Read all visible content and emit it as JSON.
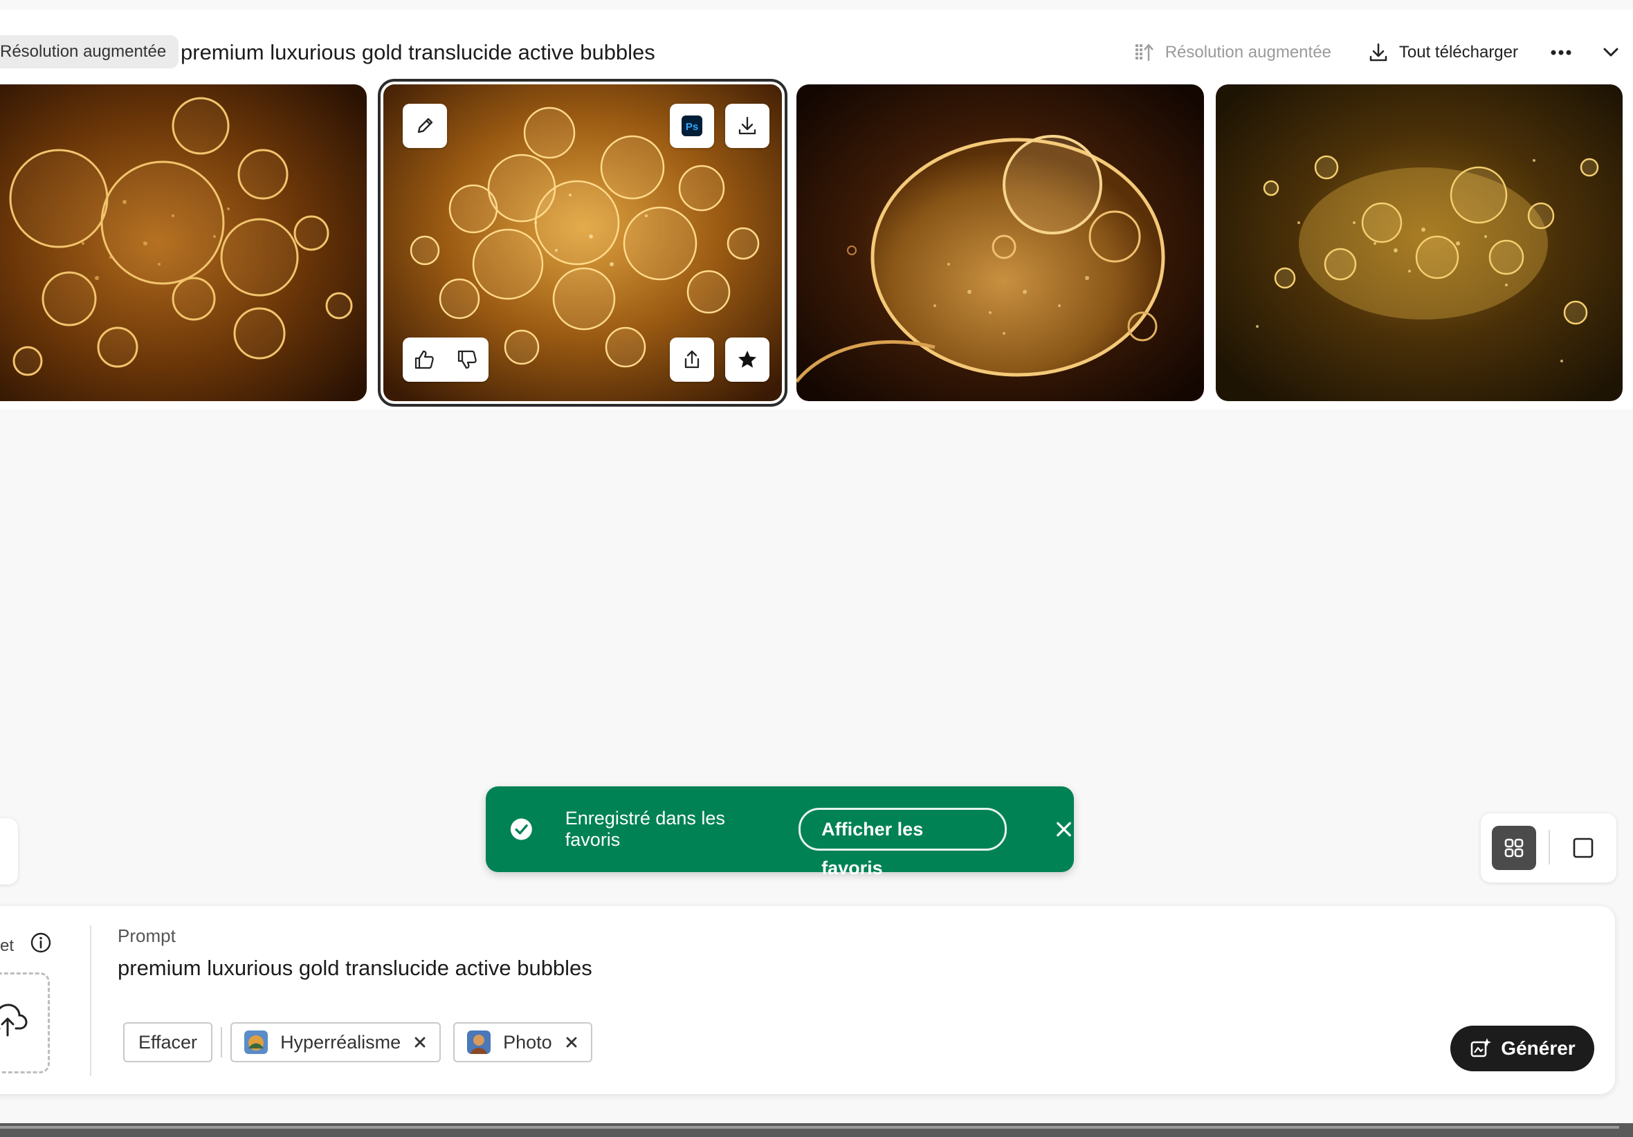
{
  "header": {
    "badge": "Résolution augmentée",
    "title": "premium luxurious gold translucide active bubbles",
    "upscale_label": "Résolution augmentée",
    "download_all_label": "Tout télécharger"
  },
  "gallery": {
    "selected_index": 1,
    "tile_actions": {
      "photoshop_label": "Ps"
    }
  },
  "toast": {
    "message": "Enregistré dans les favoris",
    "action_label": "Afficher les favoris"
  },
  "prompt_panel": {
    "side_label": "et",
    "prompt_label": "Prompt",
    "prompt_text": "premium luxurious gold translucide active bubbles",
    "clear_label": "Effacer",
    "chips": [
      {
        "label": "Hyperréalisme"
      },
      {
        "label": "Photo"
      }
    ],
    "generate_label": "Générer"
  },
  "colors": {
    "toast_bg": "#008255",
    "generate_bg": "#1c1c1c",
    "accent_gold": "#c48a2c"
  }
}
